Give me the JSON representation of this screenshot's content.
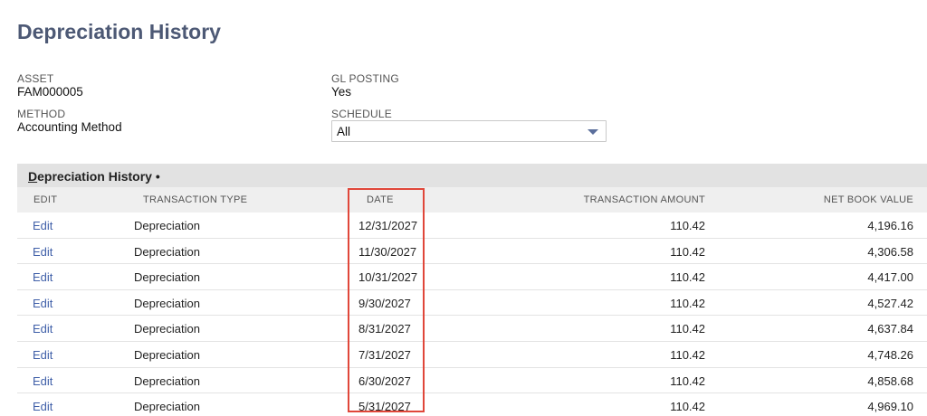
{
  "page": {
    "title": "Depreciation History"
  },
  "fields": {
    "asset": {
      "label": "ASSET",
      "value": "FAM000005"
    },
    "gl_posting": {
      "label": "GL POSTING",
      "value": "Yes"
    },
    "method": {
      "label": "METHOD",
      "value": "Accounting Method"
    },
    "schedule": {
      "label": "SCHEDULE",
      "value": "All"
    }
  },
  "section": {
    "title_prefix": "D",
    "title_rest": "epreciation History",
    "marker": " •"
  },
  "table": {
    "headers": {
      "edit": "EDIT",
      "type": "TRANSACTION TYPE",
      "date": "DATE",
      "amount": "TRANSACTION AMOUNT",
      "nbv": "NET BOOK VALUE"
    },
    "rows": [
      {
        "edit": "Edit",
        "type": "Depreciation",
        "date": "12/31/2027",
        "amount": "110.42",
        "nbv": "4,196.16"
      },
      {
        "edit": "Edit",
        "type": "Depreciation",
        "date": "11/30/2027",
        "amount": "110.42",
        "nbv": "4,306.58"
      },
      {
        "edit": "Edit",
        "type": "Depreciation",
        "date": "10/31/2027",
        "amount": "110.42",
        "nbv": "4,417.00"
      },
      {
        "edit": "Edit",
        "type": "Depreciation",
        "date": "9/30/2027",
        "amount": "110.42",
        "nbv": "4,527.42"
      },
      {
        "edit": "Edit",
        "type": "Depreciation",
        "date": "8/31/2027",
        "amount": "110.42",
        "nbv": "4,637.84"
      },
      {
        "edit": "Edit",
        "type": "Depreciation",
        "date": "7/31/2027",
        "amount": "110.42",
        "nbv": "4,748.26"
      },
      {
        "edit": "Edit",
        "type": "Depreciation",
        "date": "6/30/2027",
        "amount": "110.42",
        "nbv": "4,858.68"
      },
      {
        "edit": "Edit",
        "type": "Depreciation",
        "date": "5/31/2027",
        "amount": "110.42",
        "nbv": "4,969.10"
      }
    ]
  },
  "colors": {
    "title": "#4d5975",
    "link": "#3f5fa8",
    "highlight": "#e0473a",
    "header_bg": "#e2e2e2"
  }
}
